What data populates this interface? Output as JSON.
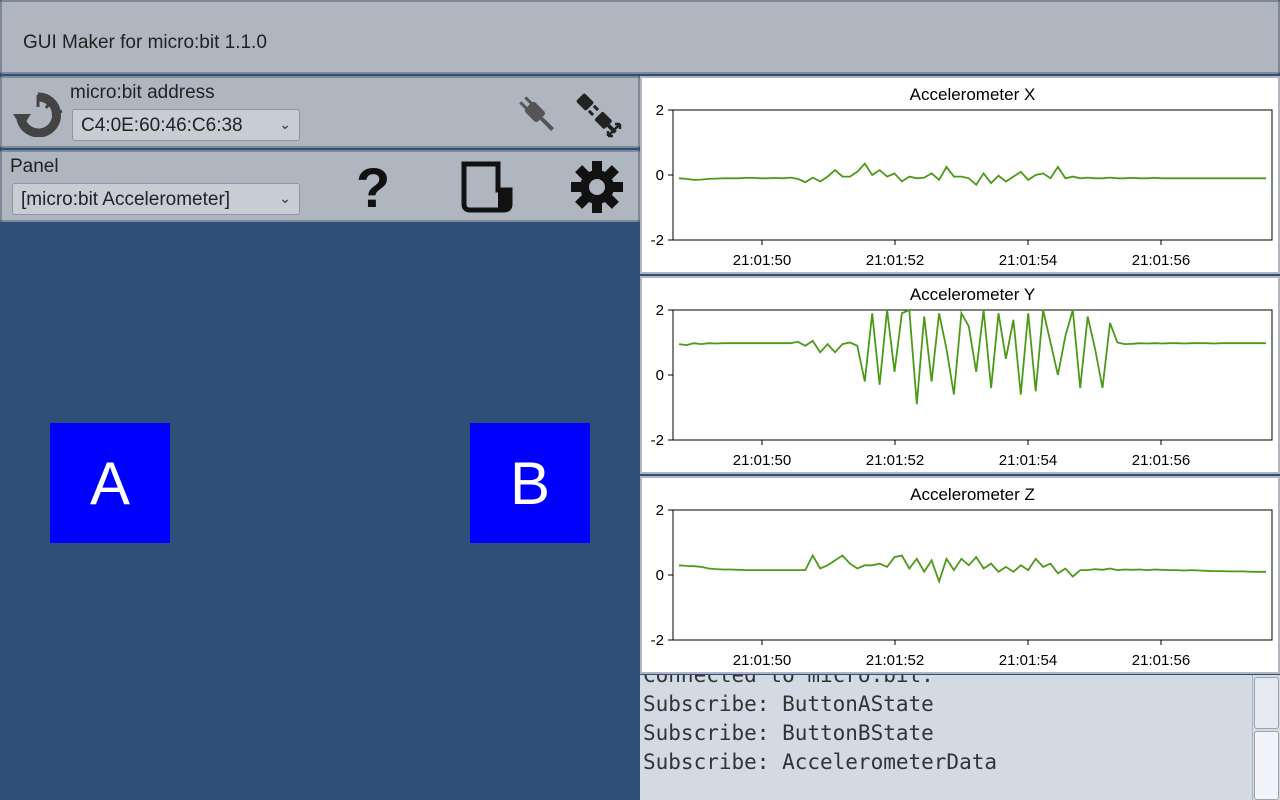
{
  "window": {
    "title": "GUI Maker for micro:bit 1.1.0"
  },
  "connection": {
    "address_label": "micro:bit address",
    "address_value": "C4:0E:60:46:C6:38",
    "icons": [
      "refresh-icon",
      "plug-connect-icon",
      "plug-disconnect-icon"
    ]
  },
  "panel": {
    "label": "Panel",
    "selected": "[micro:bit Accelerometer]",
    "icons": [
      "help-icon",
      "document-icon",
      "gear-icon"
    ]
  },
  "buttons": {
    "a_label": "A",
    "b_label": "B"
  },
  "colors": {
    "background": "#2f4e78",
    "button": "#0000ff",
    "line": "#4d9a1a",
    "panel": "#b0b6c0"
  },
  "chart_data": [
    {
      "type": "line",
      "title": "Accelerometer X",
      "ylim": [
        -2,
        2
      ],
      "yticks": [
        "2",
        "0",
        "-2"
      ],
      "xticks": [
        "21:01:50",
        "21:01:52",
        "21:01:54",
        "21:01:56"
      ],
      "series": [
        {
          "values": [
            -0.1,
            -0.12,
            -0.15,
            -0.14,
            -0.12,
            -0.11,
            -0.1,
            -0.1,
            -0.1,
            -0.09,
            -0.09,
            -0.1,
            -0.1,
            -0.09,
            -0.1,
            -0.08,
            -0.12,
            -0.22,
            -0.08,
            -0.2,
            -0.05,
            0.15,
            -0.05,
            -0.05,
            0.1,
            0.35,
            0.0,
            0.15,
            -0.05,
            0.05,
            -0.2,
            -0.05,
            -0.1,
            -0.08,
            0.05,
            -0.15,
            0.25,
            -0.05,
            -0.05,
            -0.1,
            -0.3,
            0.05,
            -0.25,
            -0.02,
            -0.2,
            -0.05,
            0.1,
            -0.15,
            0.0,
            0.05,
            -0.1,
            0.25,
            -0.1,
            -0.05,
            -0.1,
            -0.08,
            -0.1,
            -0.1,
            -0.08,
            -0.1,
            -0.1,
            -0.09,
            -0.1,
            -0.1,
            -0.09,
            -0.1,
            -0.1,
            -0.1,
            -0.1,
            -0.1,
            -0.1,
            -0.1,
            -0.1,
            -0.1,
            -0.1,
            -0.1,
            -0.1,
            -0.1,
            -0.1,
            -0.1
          ]
        }
      ]
    },
    {
      "type": "line",
      "title": "Accelerometer Y",
      "ylim": [
        -2,
        2
      ],
      "yticks": [
        "2",
        "0",
        "-2"
      ],
      "xticks": [
        "21:01:50",
        "21:01:52",
        "21:01:54",
        "21:01:56"
      ],
      "series": [
        {
          "values": [
            0.95,
            0.92,
            0.98,
            0.95,
            0.98,
            0.97,
            0.98,
            0.98,
            0.98,
            0.98,
            0.98,
            0.98,
            0.98,
            0.98,
            0.98,
            0.98,
            1.02,
            0.9,
            1.05,
            0.7,
            0.95,
            0.7,
            0.95,
            1.0,
            0.9,
            -0.2,
            1.9,
            -0.3,
            2.0,
            0.1,
            1.9,
            2.0,
            -0.9,
            1.8,
            -0.2,
            1.9,
            0.8,
            -0.6,
            1.9,
            1.5,
            0.1,
            2.0,
            -0.4,
            1.9,
            0.5,
            1.7,
            -0.6,
            1.9,
            -0.5,
            2.0,
            1.0,
            0.0,
            1.2,
            2.0,
            -0.4,
            1.8,
            0.8,
            -0.4,
            1.6,
            1.0,
            0.95,
            0.96,
            0.98,
            0.97,
            0.98,
            0.97,
            0.98,
            0.98,
            0.97,
            0.98,
            0.98,
            0.98,
            0.97,
            0.98,
            0.98,
            0.98,
            0.98,
            0.98,
            0.98,
            0.98
          ]
        }
      ]
    },
    {
      "type": "line",
      "title": "Accelerometer Z",
      "ylim": [
        -2,
        2
      ],
      "yticks": [
        "2",
        "0",
        "-2"
      ],
      "xticks": [
        "21:01:50",
        "21:01:52",
        "21:01:54",
        "21:01:56"
      ],
      "series": [
        {
          "values": [
            0.3,
            0.28,
            0.27,
            0.25,
            0.2,
            0.18,
            0.17,
            0.17,
            0.16,
            0.15,
            0.15,
            0.15,
            0.15,
            0.15,
            0.15,
            0.15,
            0.15,
            0.15,
            0.6,
            0.2,
            0.3,
            0.45,
            0.6,
            0.35,
            0.2,
            0.3,
            0.3,
            0.35,
            0.25,
            0.55,
            0.6,
            0.2,
            0.5,
            0.1,
            0.45,
            -0.2,
            0.5,
            0.15,
            0.5,
            0.3,
            0.55,
            0.2,
            0.35,
            0.1,
            0.25,
            0.1,
            0.3,
            0.15,
            0.5,
            0.25,
            0.35,
            0.05,
            0.2,
            -0.05,
            0.15,
            0.15,
            0.18,
            0.16,
            0.2,
            0.15,
            0.17,
            0.16,
            0.17,
            0.15,
            0.17,
            0.16,
            0.15,
            0.15,
            0.14,
            0.15,
            0.14,
            0.13,
            0.12,
            0.12,
            0.11,
            0.11,
            0.11,
            0.1,
            0.1,
            0.1
          ]
        }
      ]
    }
  ],
  "log": {
    "lines": [
      "Connected to micro:bit.",
      "Subscribe: ButtonAState",
      "Subscribe: ButtonBState",
      "Subscribe: AccelerometerData"
    ]
  }
}
